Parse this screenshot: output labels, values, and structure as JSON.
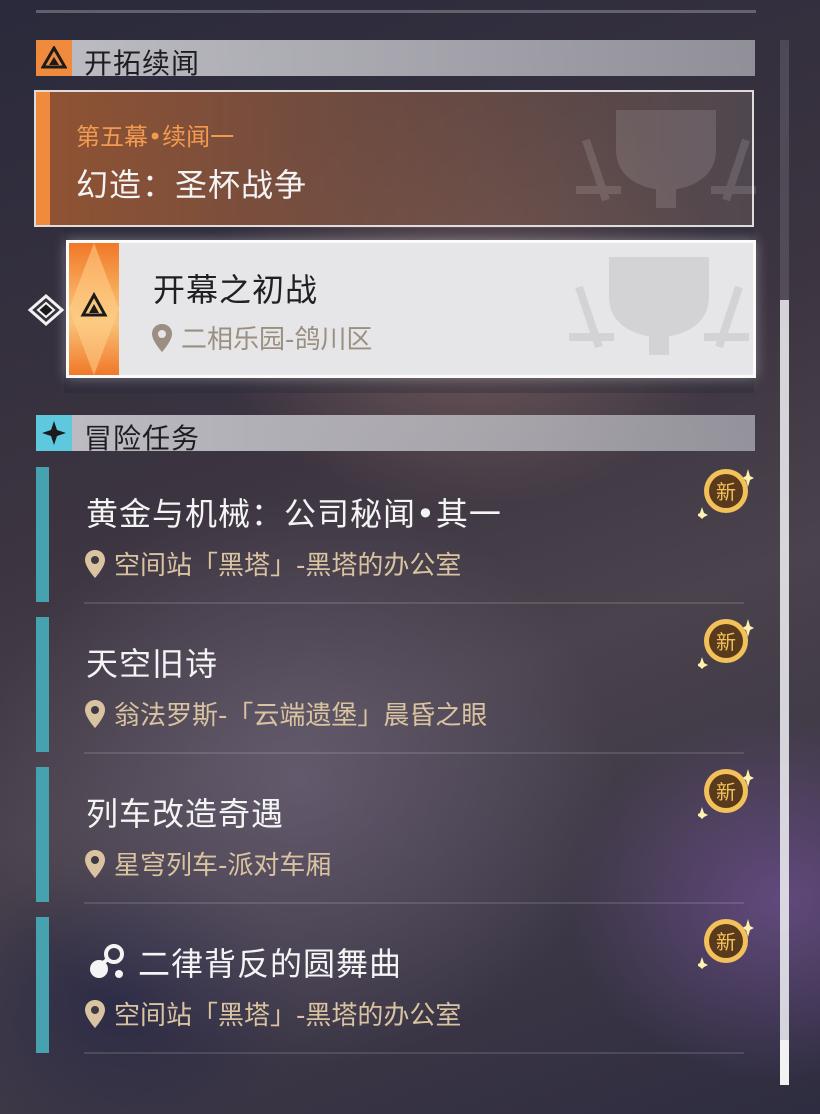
{
  "sections": {
    "trailblaze": {
      "title": "开拓续闻"
    },
    "adventure": {
      "title": "冒险任务"
    }
  },
  "featured": {
    "chapter": "第五幕•续闻一",
    "name": "幻造：圣杯战争"
  },
  "sub_quest": {
    "name": "开幕之初战",
    "location": "二相乐园-鸽川区",
    "selected": true
  },
  "quests": [
    {
      "name": "黄金与机械：公司秘闻•其一",
      "location": "空间站「黑塔」-黑塔的办公室",
      "badge": "新"
    },
    {
      "name": "天空旧诗",
      "location": "翁法罗斯-「云端遗堡」晨昏之眼",
      "badge": "新"
    },
    {
      "name": "列车改造奇遇",
      "location": "星穹列车-派对车厢",
      "badge": "新"
    },
    {
      "name": "二律背反的圆舞曲",
      "location": "空间站「黑塔」-黑塔的办公室",
      "badge": "新",
      "has_icon": true
    }
  ],
  "colors": {
    "trailblaze_accent": "#f08a3c",
    "adventure_accent": "#47a2b0",
    "location_text": "#d9c3a0",
    "new_badge": "#f3c15a"
  },
  "icons": {
    "trailblaze_badge": "triangle-emblem-icon",
    "adventure_badge": "four-point-star-icon",
    "location": "map-pin-icon",
    "pointer": "selected-arrow-icon",
    "special_quest": "molecule-icon"
  }
}
